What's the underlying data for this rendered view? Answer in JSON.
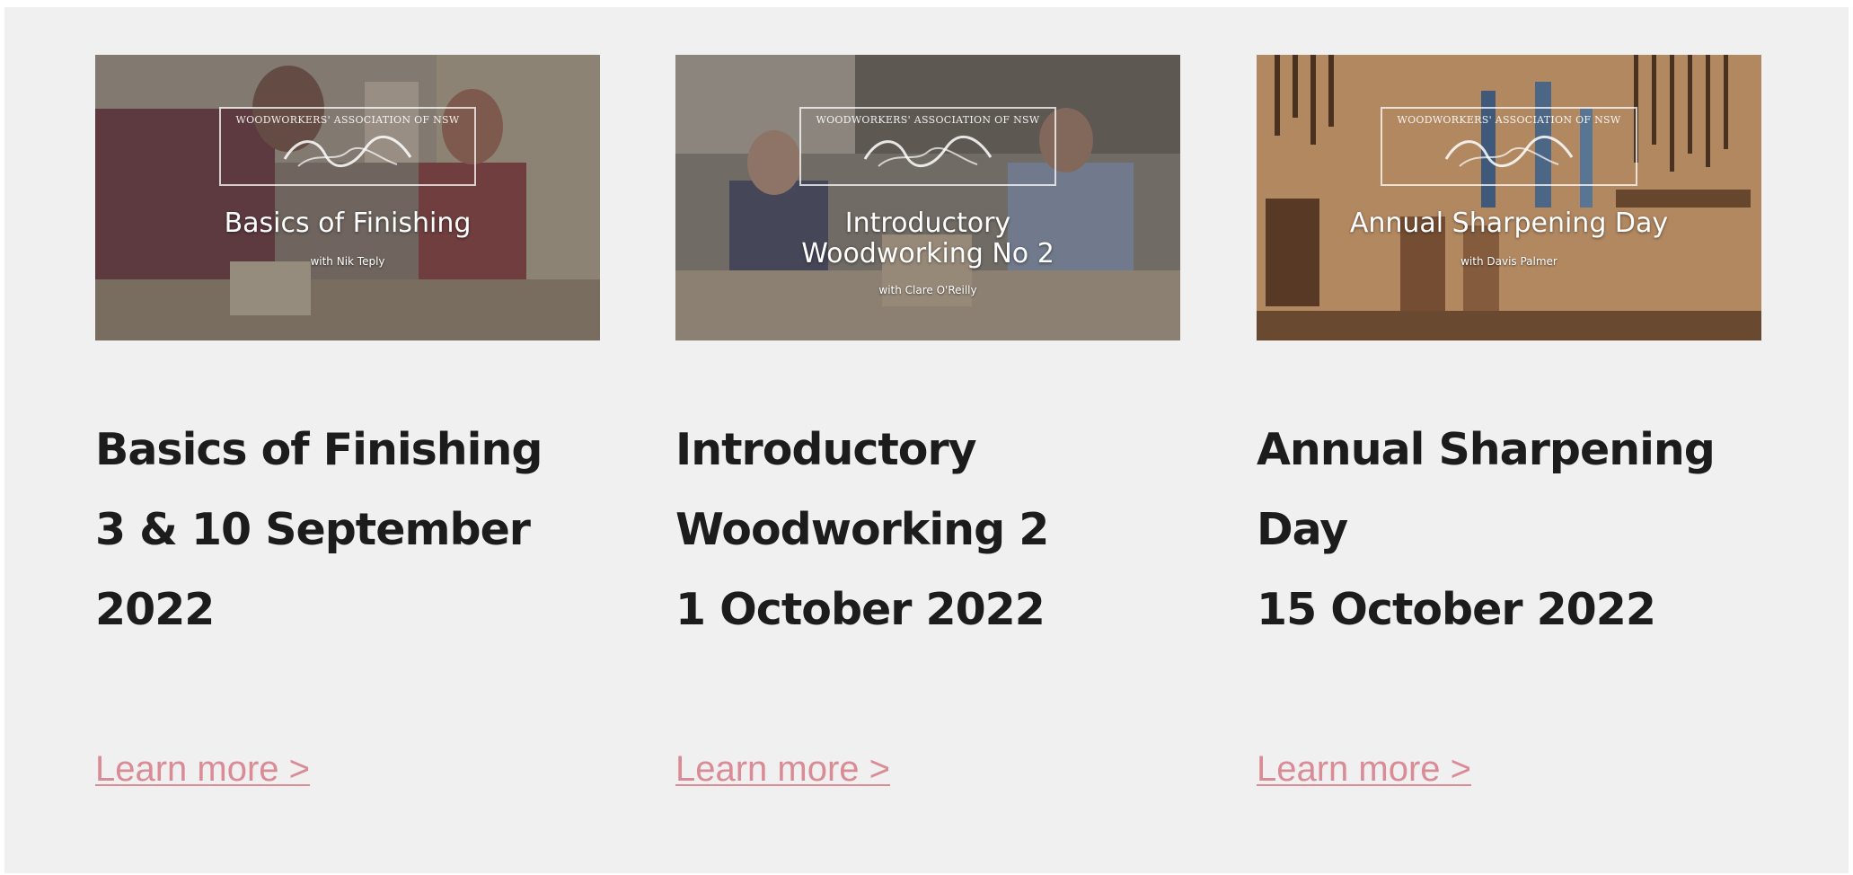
{
  "logo_text": "WOODWORKERS' ASSOCIATION OF NSW",
  "colors": {
    "panel_bg": "#f0f0f0",
    "heading": "#1c1c1c",
    "link": "#d98b96",
    "overlay_text": "#ffffff"
  },
  "cards": [
    {
      "thumbnail": {
        "title": "Basics of Finishing",
        "subtitle": "with Nik Teply"
      },
      "heading_lines": [
        "Basics of Finishing",
        "3 & 10 September",
        "2022"
      ],
      "link_label": "Learn more >"
    },
    {
      "thumbnail": {
        "title_lines": [
          "Introductory",
          "Woodworking No 2"
        ],
        "subtitle": "with Clare O'Reilly"
      },
      "heading_lines": [
        "Introductory",
        "Woodworking 2",
        "1 October 2022"
      ],
      "link_label": "Learn more >"
    },
    {
      "thumbnail": {
        "title": "Annual Sharpening Day",
        "subtitle": "with Davis Palmer"
      },
      "heading_lines": [
        "Annual Sharpening",
        "Day",
        "15 October 2022"
      ],
      "link_label": "Learn more >"
    }
  ]
}
